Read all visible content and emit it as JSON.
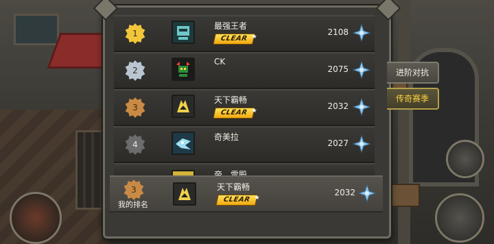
{
  "leaderboard": {
    "rows": [
      {
        "rank": "1",
        "name": "最强王者",
        "clear": "CLEAR",
        "score": "2108",
        "badge_color": "#f2c63a",
        "avatar_bg": "#1f5d62"
      },
      {
        "rank": "2",
        "name": "CK",
        "clear": "",
        "score": "2075",
        "badge_color": "#b9c6d1",
        "avatar_bg": "#2a6a3a"
      },
      {
        "rank": "3",
        "name": "天下霸畅",
        "clear": "CLEAR",
        "score": "2032",
        "badge_color": "#c98a45",
        "avatar_bg": "#d4b43a"
      },
      {
        "rank": "4",
        "name": "奇美拉",
        "clear": "",
        "score": "2027",
        "badge_color": "#6c6c6c",
        "avatar_bg": "#3a8ca8"
      }
    ],
    "partial_row": {
      "name": "帝、雪殿"
    }
  },
  "my_rank": {
    "label": "我的排名",
    "rank": "3",
    "name": "天下霸畅",
    "clear": "CLEAR",
    "score": "2032"
  },
  "side_tabs": [
    {
      "label": "进阶对抗",
      "active": false
    },
    {
      "label": "传奇赛季",
      "active": true
    }
  ],
  "colors": {
    "accent": "#ffd23e",
    "cross_icon": "#8fc6ee"
  }
}
